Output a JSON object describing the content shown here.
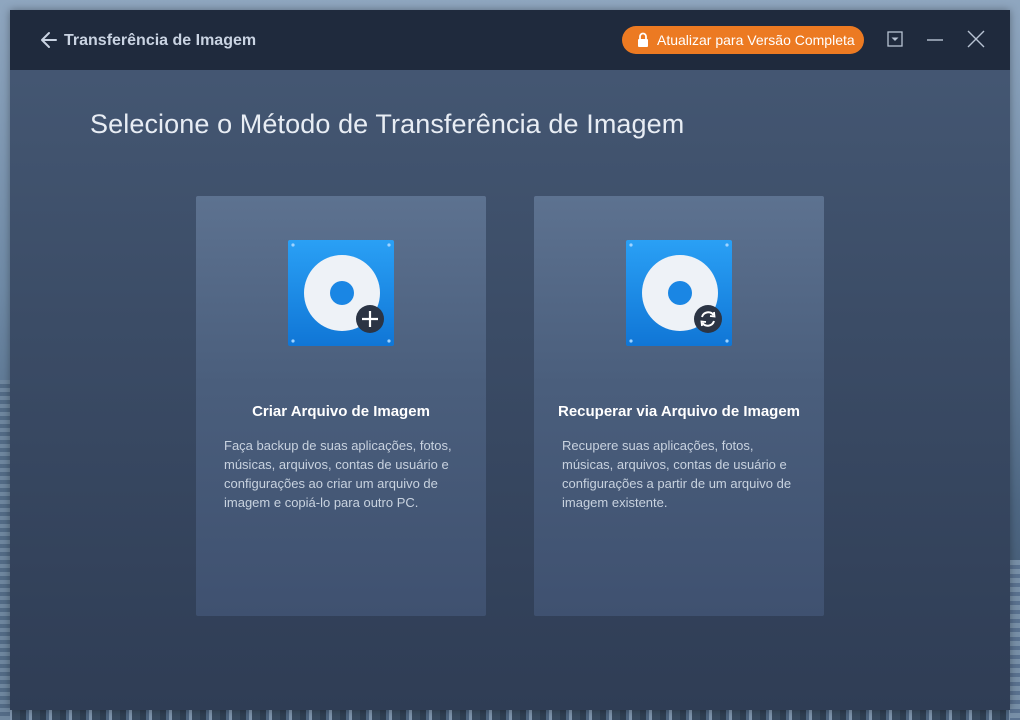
{
  "window": {
    "title": "Transferência de Imagem",
    "upgrade_label": "Atualizar para Versão Completa"
  },
  "icons": {
    "back": "arrow-left-icon",
    "lock": "lock-icon",
    "dropdown": "dropdown-menu-icon",
    "minimize": "minimize-icon",
    "close": "close-icon",
    "create": "disk-plus-icon",
    "recover": "disk-refresh-icon"
  },
  "colors": {
    "titlebar": "#1f2a3d",
    "accent": "#ec7a22",
    "icon_blue": "#1c8de8"
  },
  "main": {
    "heading": "Selecione o Método de Transferência de Imagem",
    "cards": [
      {
        "title": "Criar Arquivo de Imagem",
        "description": "Faça backup de suas aplicações, fotos, músicas, arquivos, contas de usuário e configurações ao criar um arquivo de imagem e copiá-lo para outro PC."
      },
      {
        "title": "Recuperar via Arquivo de Imagem",
        "description": "Recupere suas aplicações, fotos, músicas, arquivos, contas de usuário e configurações a partir de um arquivo de imagem existente."
      }
    ]
  }
}
